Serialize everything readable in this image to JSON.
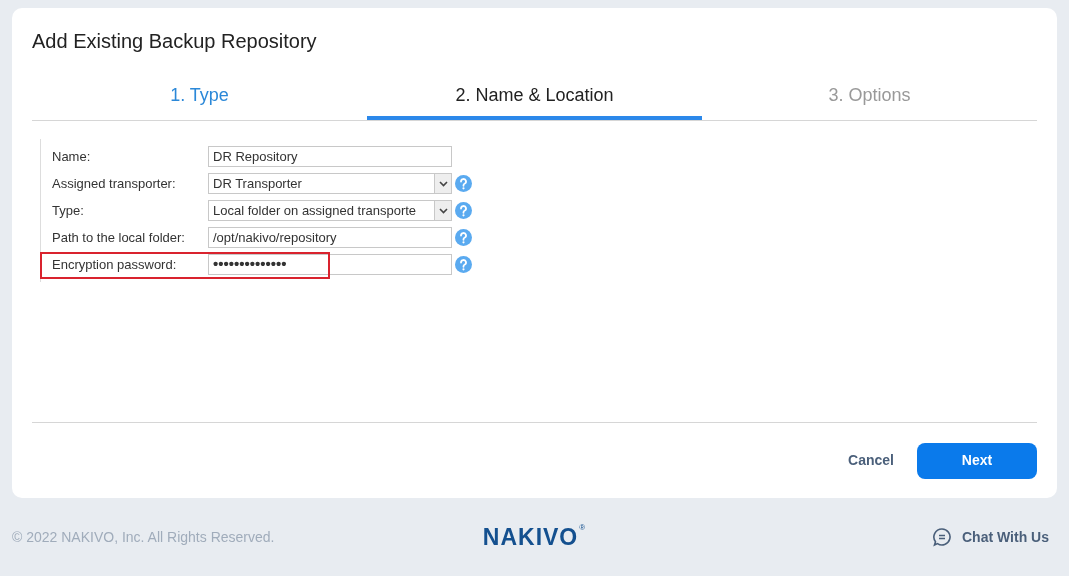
{
  "dialog": {
    "title": "Add Existing Backup Repository"
  },
  "steps": [
    {
      "label": "1. Type",
      "completed": true,
      "selected": false
    },
    {
      "label": "2. Name & Location",
      "completed": false,
      "selected": true
    },
    {
      "label": "3. Options",
      "completed": false,
      "selected": false
    }
  ],
  "fields": [
    {
      "label": "Name:",
      "kind": "text",
      "value": "DR Repository",
      "help": false,
      "highlighted": false
    },
    {
      "label": "Assigned transporter:",
      "kind": "select",
      "value": "DR Transporter",
      "help": true,
      "highlighted": false
    },
    {
      "label": "Type:",
      "kind": "select",
      "value": "Local folder on assigned transporte",
      "help": true,
      "highlighted": false
    },
    {
      "label": "Path to the local folder:",
      "kind": "text",
      "value": "/opt/nakivo/repository",
      "help": true,
      "highlighted": false
    },
    {
      "label": "Encryption password:",
      "kind": "password",
      "value": "••••••••••••••",
      "help": true,
      "highlighted": true
    }
  ],
  "buttons": {
    "cancel": "Cancel",
    "next": "Next"
  },
  "footer": {
    "copyright": "© 2022 NAKIVO, Inc. All Rights Reserved.",
    "logo": "NAKIVO",
    "logo_mark": "®",
    "chat": "Chat With Us"
  }
}
